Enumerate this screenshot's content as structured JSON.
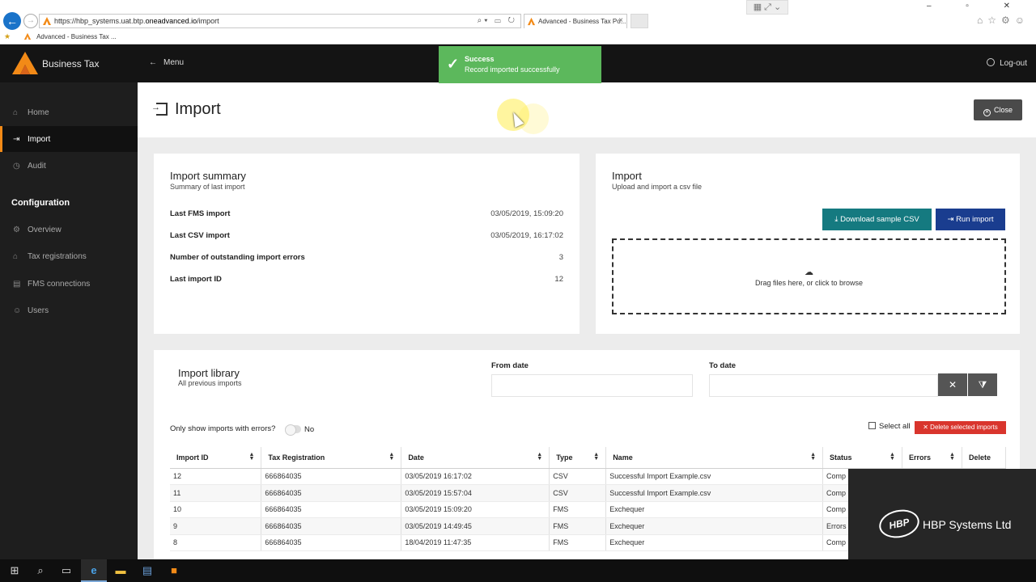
{
  "browser": {
    "url_prefix": "https://hbp_systems.uat.btp.",
    "url_domain": "oneadvanced.io",
    "url_path": "/import",
    "tab_title": "Advanced - Business Tax Po...",
    "favorite": "Advanced - Business Tax ..."
  },
  "app": {
    "brand": "Business Tax",
    "menu_label": "Menu",
    "logout_label": "Log-out",
    "accent_color": "#f28a17"
  },
  "toast": {
    "title": "Success",
    "message": "Record imported successfully",
    "color": "#5cb85c"
  },
  "sidebar": {
    "items": [
      {
        "label": "Home",
        "icon": "home-icon"
      },
      {
        "label": "Import",
        "icon": "import-icon",
        "active": true
      },
      {
        "label": "Audit",
        "icon": "clock-icon"
      }
    ],
    "config_title": "Configuration",
    "config_items": [
      {
        "label": "Overview",
        "icon": "gear-icon"
      },
      {
        "label": "Tax registrations",
        "icon": "bank-icon"
      },
      {
        "label": "FMS connections",
        "icon": "connection-icon"
      },
      {
        "label": "Users",
        "icon": "users-icon"
      }
    ]
  },
  "page": {
    "title": "Import",
    "close_label": "Close"
  },
  "summary": {
    "title": "Import summary",
    "subtitle": "Summary of last import",
    "rows": [
      {
        "label": "Last FMS import",
        "value": "03/05/2019, 15:09:20"
      },
      {
        "label": "Last CSV import",
        "value": "03/05/2019, 16:17:02"
      },
      {
        "label": "Number of outstanding import errors",
        "value": "3"
      },
      {
        "label": "Last import ID",
        "value": "12"
      }
    ]
  },
  "import_card": {
    "title": "Import",
    "subtitle": "Upload and import a csv file",
    "download_label": "Download sample CSV",
    "run_label": "Run import",
    "dropzone_text": "Drag files here, or click to browse"
  },
  "library": {
    "title": "Import library",
    "subtitle": "All previous imports",
    "from_label": "From date",
    "to_label": "To date",
    "errors_toggle_label": "Only show imports with errors?",
    "errors_toggle_value": "No",
    "select_all_label": "Select all",
    "delete_selected_label": "Delete selected imports",
    "columns": [
      "Import ID",
      "Tax Registration",
      "Date",
      "Type",
      "Name",
      "Status",
      "Errors",
      "Delete"
    ],
    "rows": [
      [
        "12",
        "666864035",
        "03/05/2019 16:17:02",
        "CSV",
        "Successful Import Example.csv",
        "Comp"
      ],
      [
        "11",
        "666864035",
        "03/05/2019 15:57:04",
        "CSV",
        "Successful Import Example.csv",
        "Comp"
      ],
      [
        "10",
        "666864035",
        "03/05/2019 15:09:20",
        "FMS",
        "Exchequer",
        "Comp"
      ],
      [
        "9",
        "666864035",
        "03/05/2019 14:49:45",
        "FMS",
        "Exchequer",
        "Errors"
      ],
      [
        "8",
        "666864035",
        "18/04/2019 11:47:35",
        "FMS",
        "Exchequer",
        "Comp"
      ]
    ]
  },
  "watermark": {
    "mark": "HBP",
    "company": "HBP Systems Ltd"
  }
}
